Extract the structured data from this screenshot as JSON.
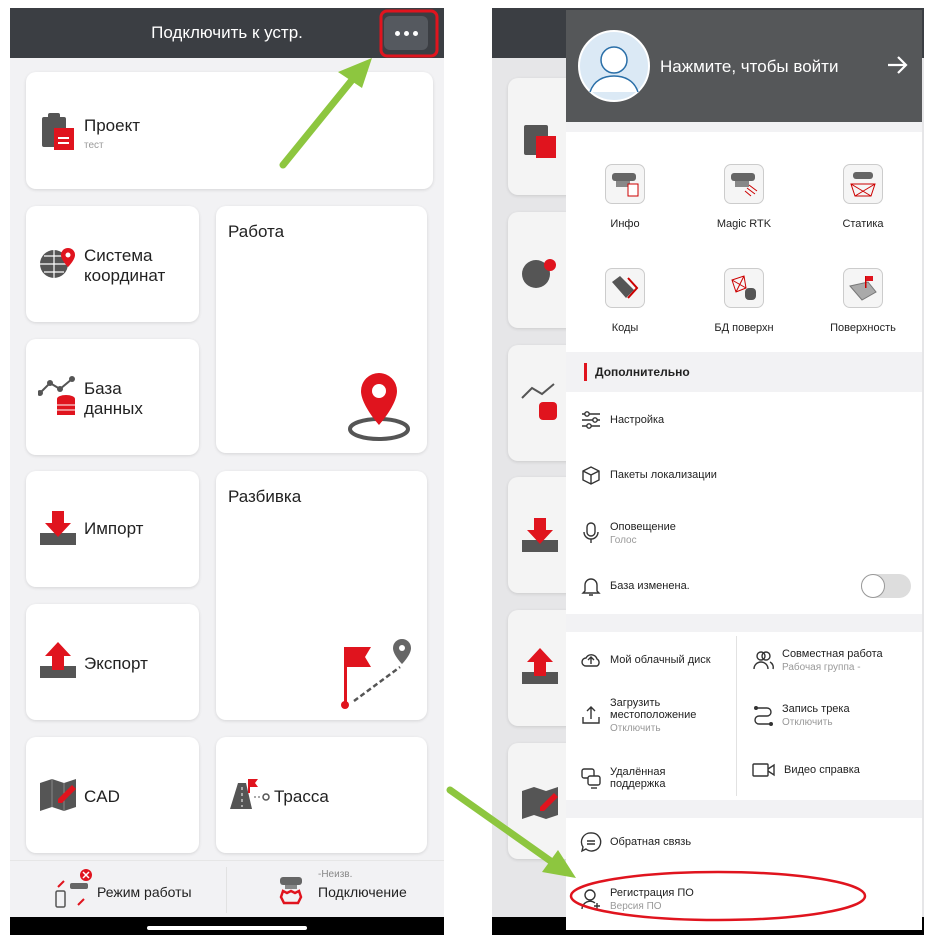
{
  "left": {
    "header": {
      "title": "Подключить к устр.",
      "menu_icon": "more-dots-icon"
    },
    "cards": {
      "project": {
        "label": "Проект",
        "sub": "тест"
      },
      "coords": {
        "label1": "Система",
        "label2": "координат"
      },
      "work": {
        "label": "Работа"
      },
      "db": {
        "label1": "База",
        "label2": "данных"
      },
      "import": {
        "label": "Импорт"
      },
      "stakeout": {
        "label": "Разбивка"
      },
      "export": {
        "label": "Экспорт"
      },
      "cad": {
        "label": "CAD"
      },
      "route": {
        "label": "Трасса"
      }
    },
    "bottom": {
      "mode": "Режим работы",
      "conn_status": "-Неизв.",
      "conn": "Подключение"
    }
  },
  "drawer": {
    "login": "Нажмите, чтобы войти",
    "grid": [
      "Инфо",
      "Magic RTK",
      "Статика",
      "Коды",
      "БД поверхн",
      "Поверхность"
    ],
    "section": "Дополнительно",
    "list": {
      "settings": "Настройка",
      "packages": "Пакеты локализации",
      "voice": "Оповещение",
      "voice_sub": "Голос",
      "base_changed": "База изменена.",
      "base_toggle": false
    },
    "grid2": {
      "cloud": "Мой облачный диск",
      "collab": "Совместная работа",
      "collab_sub": "Рабочая группа -",
      "upload1": "Загрузить",
      "upload2": "местоположение",
      "upload_sub": "Отключить",
      "track": "Запись трека",
      "track_sub": "Отключить",
      "remote1": "Удалённая",
      "remote2": "поддержка",
      "video": "Видео справка"
    },
    "feedback": "Обратная связь",
    "register": "Регистрация ПО",
    "register_sub": "Версия ПО"
  },
  "colors": {
    "accent": "#e0141e",
    "header": "#3b3e43",
    "arrow": "#8dc63f"
  }
}
